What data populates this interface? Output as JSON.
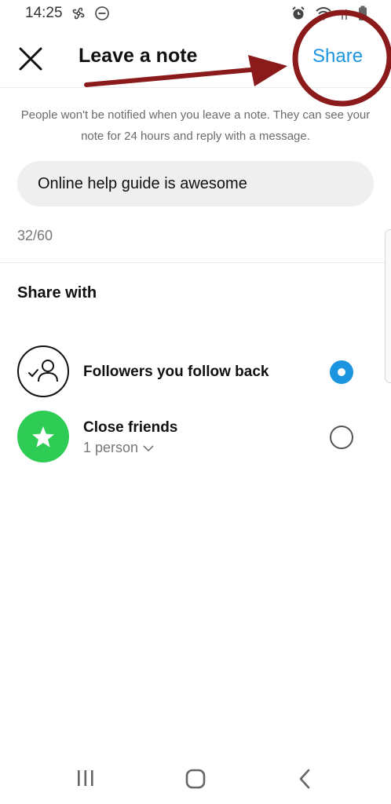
{
  "status_bar": {
    "time": "14:25",
    "left_icons": [
      "pinwheel-icon",
      "do-not-disturb-icon"
    ],
    "right_icons": [
      "alarm-icon",
      "wifi-icon",
      "signal-icon",
      "battery-icon"
    ]
  },
  "header": {
    "close_icon": "close-icon",
    "title": "Leave a note",
    "share_label": "Share"
  },
  "notice": "People won't be notified when you leave a note. They can see your note for 24 hours and reply with a message.",
  "note": {
    "value": "Online help guide is awesome",
    "counter": "32/60"
  },
  "share_with": {
    "title": "Share with",
    "options": [
      {
        "label": "Followers you follow back",
        "icon": "followers-icon",
        "selected": true
      },
      {
        "label": "Close friends",
        "sub": "1 person",
        "icon": "star-icon",
        "selected": false
      }
    ]
  },
  "colors": {
    "accent": "#1b95e0",
    "close_friends": "#2ecc55",
    "annotation": "#8b1a1a"
  },
  "nav": [
    "recent-apps-icon",
    "home-icon",
    "back-icon"
  ]
}
